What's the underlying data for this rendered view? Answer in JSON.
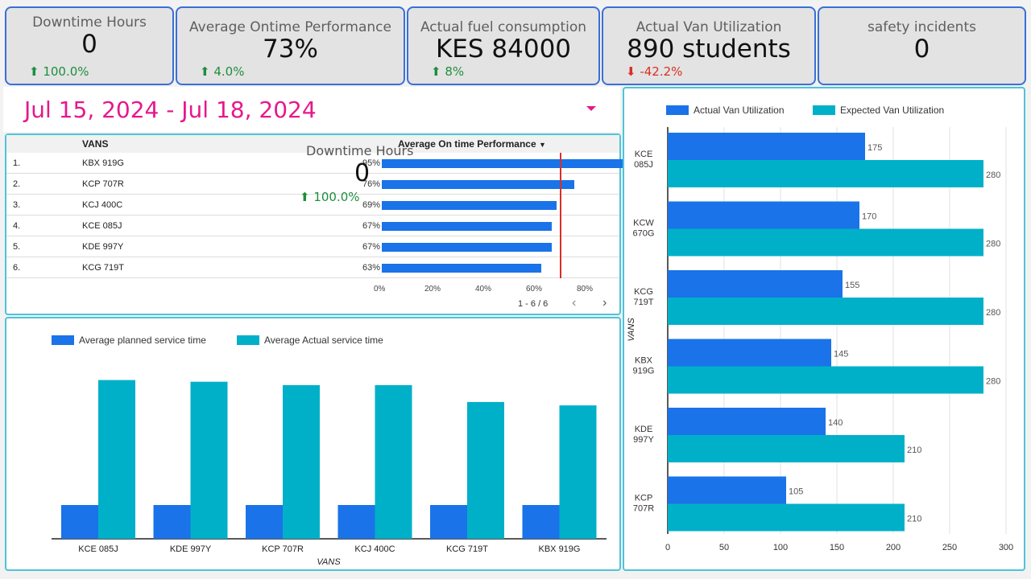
{
  "kpis": [
    {
      "title": "Downtime Hours",
      "value": "0",
      "delta": "100.0%",
      "dir": "up"
    },
    {
      "title": "Average Ontime Performance",
      "value": "73%",
      "delta": "4.0%",
      "dir": "up"
    },
    {
      "title": "Actual fuel consumption",
      "value": "KES 84000",
      "delta": "8%",
      "dir": "up"
    },
    {
      "title": "Actual Van Utilization",
      "value": "890 students",
      "delta": "-42.2%",
      "dir": "down"
    },
    {
      "title": "safety incidents",
      "value": "0",
      "delta": "",
      "dir": ""
    }
  ],
  "date_range": "Jul 15, 2024 - Jul 18, 2024",
  "table": {
    "col_vans": "VANS",
    "col_metric": "Average On time Performance",
    "rows": [
      {
        "n": "1.",
        "van": "KBX 919G",
        "pct": "95%",
        "v": 95
      },
      {
        "n": "2.",
        "van": "KCP 707R",
        "pct": "76%",
        "v": 76
      },
      {
        "n": "3.",
        "van": "KCJ 400C",
        "pct": "69%",
        "v": 69
      },
      {
        "n": "4.",
        "van": "KCE 085J",
        "pct": "67%",
        "v": 67
      },
      {
        "n": "5.",
        "van": "KDE 997Y",
        "pct": "67%",
        "v": 67
      },
      {
        "n": "6.",
        "van": "KCG 719T",
        "pct": "63%",
        "v": 63
      }
    ],
    "axis_ticks": [
      "0%",
      "20%",
      "40%",
      "60%",
      "80%"
    ],
    "reference_line": 70,
    "pagination": "1 - 6 / 6"
  },
  "overlay": {
    "title": "Downtime Hours",
    "value": "0",
    "delta": "100.0%"
  },
  "chart_data": [
    {
      "type": "bar",
      "title": "",
      "xlabel": "VANS",
      "categories": [
        "KCE 085J",
        "KDE 997Y",
        "KCP 707R",
        "KCJ 400C",
        "KCG 719T",
        "KBX 919G"
      ],
      "series": [
        {
          "name": "Average planned service time",
          "values": [
            20,
            20,
            20,
            20,
            20,
            20
          ],
          "color": "#1a73e8"
        },
        {
          "name": "Average Actual service time",
          "values": [
            94,
            93,
            91,
            91,
            81,
            79
          ],
          "color": "#00b0c8"
        }
      ],
      "ylim": [
        0,
        100
      ],
      "legend": "top-left"
    },
    {
      "type": "bar",
      "orientation": "horizontal",
      "ylabel": "VANS",
      "categories": [
        "KCE 085J",
        "KCW 670G",
        "KCG 719T",
        "KBX 919G",
        "KDE 997Y",
        "KCP 707R"
      ],
      "series": [
        {
          "name": "Actual Van Utilization",
          "values": [
            175,
            170,
            155,
            145,
            140,
            105
          ],
          "color": "#1a73e8"
        },
        {
          "name": "Expected Van Utilization",
          "values": [
            280,
            280,
            280,
            280,
            210,
            210
          ],
          "color": "#00b0c8"
        }
      ],
      "xlim": [
        0,
        300
      ],
      "xticks": [
        "0",
        "50",
        "100",
        "150",
        "200",
        "250",
        "300"
      ],
      "legend": "top"
    }
  ],
  "colors": {
    "accent": "#1a73e8",
    "teal": "#00b0c8",
    "date": "#e6188c",
    "border": "#3a6fd8"
  }
}
